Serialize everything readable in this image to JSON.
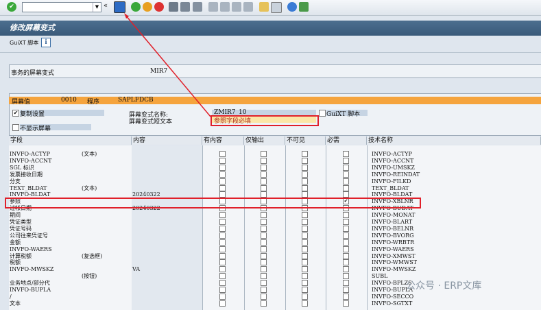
{
  "toolbar": {
    "command_value": "",
    "back_glyph": "«"
  },
  "title": "修改屏幕变式",
  "guixt_label": "GuiXT 脚本",
  "info_glyph": "i",
  "variant_label": "事务的屏幕变式",
  "variant_value": "MIR7",
  "screen_values": {
    "label": "屏幕值",
    "number": "0010",
    "program_label": "程序",
    "program": "SAPLFDCB"
  },
  "copy_settings": "复制设置",
  "no_display": "不显示屏幕",
  "variant_name_label": "屏幕变式名称:",
  "variant_name_value": "ZMIR7_10",
  "short_text_label": "屏幕变式短文本",
  "short_text_value": "参照字段必填",
  "guixt_check": "GuiXT 脚本",
  "columns": [
    "字段",
    "内容",
    "有内容",
    "仅输出",
    "不可见",
    "必需",
    "技术名称"
  ],
  "rows": [
    {
      "field": "INVFO-ACTYP",
      "type": "(文本)",
      "content": "",
      "req": false,
      "tech": "INVFO-ACTYP"
    },
    {
      "field": "INVFO-ACCNT",
      "type": "",
      "content": "",
      "req": false,
      "tech": "INVFO-ACCNT"
    },
    {
      "field": "SGL 标识",
      "type": "",
      "content": "",
      "req": false,
      "tech": "INVFO-UMSKZ"
    },
    {
      "field": "发票接收日期",
      "type": "",
      "content": "",
      "req": false,
      "tech": "INVFO-REINDAT"
    },
    {
      "field": "分支",
      "type": "",
      "content": "",
      "req": false,
      "tech": "INVFO-FILKD"
    },
    {
      "field": "TEXT_BLDAT",
      "type": "(文本)",
      "content": "",
      "req": false,
      "tech": "TEXT_BLDAT"
    },
    {
      "field": "INVFO-BLDAT",
      "type": "",
      "content": "20240322",
      "req": false,
      "tech": "INVFO-BLDAT"
    },
    {
      "field": "参照",
      "type": "",
      "content": "",
      "req": true,
      "tech": "INVFO-XBLNR"
    },
    {
      "field": "过帐日期",
      "type": "",
      "content": "20240322",
      "req": false,
      "tech": "INVFO-BUDAT"
    },
    {
      "field": "期间",
      "type": "",
      "content": "",
      "req": false,
      "tech": "INVFO-MONAT"
    },
    {
      "field": "凭证类型",
      "type": "",
      "content": "",
      "req": false,
      "tech": "INVFO-BLART"
    },
    {
      "field": "凭证号码",
      "type": "",
      "content": "",
      "req": false,
      "tech": "INVFO-BELNR"
    },
    {
      "field": "公司往来凭证号",
      "type": "",
      "content": "",
      "req": false,
      "tech": "INVFO-BVORG"
    },
    {
      "field": "金额",
      "type": "",
      "content": "",
      "req": false,
      "tech": "INVFO-WRBTR"
    },
    {
      "field": "INVFO-WAERS",
      "type": "",
      "content": "",
      "req": false,
      "tech": "INVFO-WAERS"
    },
    {
      "field": "计算税额",
      "type": "(复选框)",
      "content": "",
      "req": false,
      "tech": "INVFO-XMWST"
    },
    {
      "field": "税额",
      "type": "",
      "content": "",
      "req": false,
      "tech": "INVFO-WMWST"
    },
    {
      "field": "INVFO-MWSKZ",
      "type": "",
      "content": "VA",
      "req": false,
      "tech": "INVFO-MWSKZ"
    },
    {
      "field": "",
      "type": "(按钮)",
      "content": "",
      "req": false,
      "tech": "SUBL"
    },
    {
      "field": "业务地点/部分代",
      "type": "",
      "content": "",
      "req": false,
      "tech": "INVFO-BPLZS"
    },
    {
      "field": "INVFO-BUPLA",
      "type": "",
      "content": "",
      "req": false,
      "tech": "INVFO-BUPLA"
    },
    {
      "field": "/",
      "type": "",
      "content": "",
      "req": false,
      "tech": "INVFO-SECCO"
    },
    {
      "field": "文本",
      "type": "",
      "content": "",
      "req": false,
      "tech": "INVFO-SGTXT"
    }
  ],
  "watermark": "公众号 · ERP文库"
}
